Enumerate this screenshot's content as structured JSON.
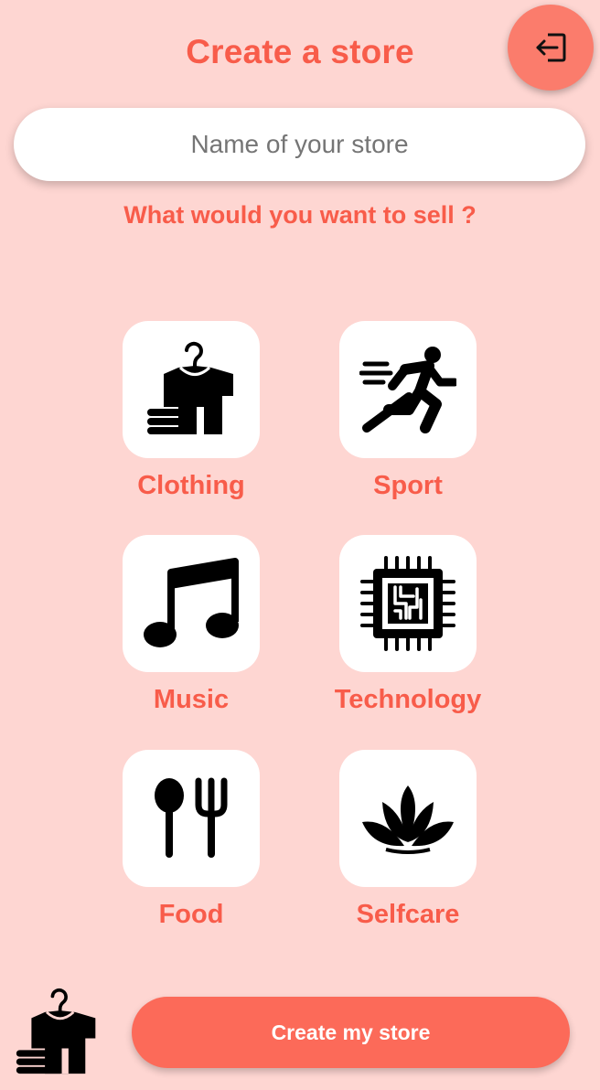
{
  "header": {
    "title": "Create a store",
    "logout_icon": "logout-icon"
  },
  "store_name": {
    "placeholder": "Name of your store",
    "value": ""
  },
  "question": "What would you want to sell ?",
  "categories": [
    {
      "label": "Clothing",
      "icon": "clothing-hanger-icon"
    },
    {
      "label": "Sport",
      "icon": "running-person-icon"
    },
    {
      "label": "Music",
      "icon": "music-note-icon"
    },
    {
      "label": "Technology",
      "icon": "microchip-icon"
    },
    {
      "label": "Food",
      "icon": "spoon-fork-icon"
    },
    {
      "label": "Selfcare",
      "icon": "lotus-icon"
    }
  ],
  "footer": {
    "logo_icon": "clothing-hanger-icon",
    "create_button_label": "Create my store"
  },
  "colors": {
    "background": "#FED6D2",
    "accent": "#F85C4A",
    "button": "#FC6A59",
    "logout_button": "#FB7C6C",
    "tile": "#FFFFFF"
  }
}
